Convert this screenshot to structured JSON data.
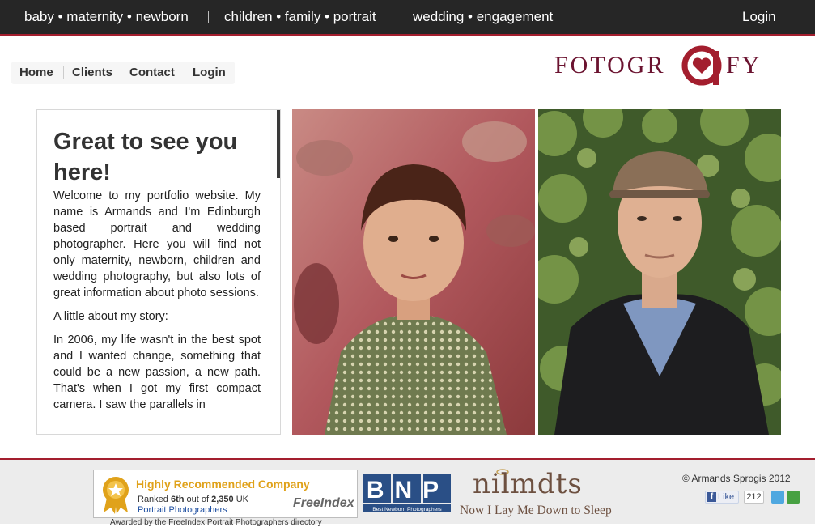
{
  "top_nav": {
    "items": [
      "baby • maternity • newborn",
      "children • family • portrait",
      "wedding • engagement"
    ],
    "login": "Login"
  },
  "sub_nav": {
    "items": [
      "Home",
      "Clients",
      "Contact",
      "Login"
    ]
  },
  "logo": {
    "text_left": "FOTOGR",
    "text_right": "FY",
    "accent_color": "#a31e2e"
  },
  "welcome": {
    "title": "Great to see you here!",
    "paragraph1": "Welcome to my portfolio website. My name is Armands and I'm Edinburgh based portrait and wedding photographer. Here you will find not only maternity, newborn, children and wedding photography, but also lots of great information about photo sessions.",
    "paragraph2": "A little about my story:",
    "paragraph3": "In 2006, my life wasn't in the best spot and I wanted change, something that could be a new passion, a new path. That's when I got my first compact camera. I saw the parallels in"
  },
  "footer": {
    "freeindex": {
      "title": "Highly Recommended Company",
      "rank_prefix": "Ranked ",
      "rank": "6th",
      "rank_mid": " out of ",
      "total": "2,350",
      "rank_suffix": " UK",
      "category": "Portrait Photographers",
      "logo_text": "FreeIndex"
    },
    "bnp": {
      "letters": "BNP",
      "caption": "Best Newborn Photographers"
    },
    "nilmdts": {
      "word": "nilmdts",
      "subtitle": "Now I Lay Me Down to Sleep"
    },
    "copyright": "© Armands Sprogis 2012",
    "fb_like": "Like",
    "fb_count": "212",
    "bottom_cut_text": "Awarded by the FreeIndex Portrait Photographers directory"
  },
  "colors": {
    "topbar_bg": "#262626",
    "accent": "#a31e2e",
    "text": "#333333"
  }
}
